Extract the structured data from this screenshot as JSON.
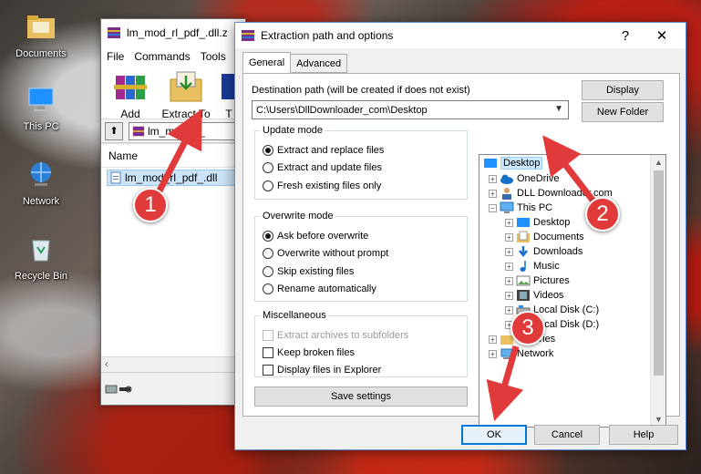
{
  "desktop": {
    "icons": [
      {
        "label": "Documents"
      },
      {
        "label": "This PC"
      },
      {
        "label": "Network"
      },
      {
        "label": "Recycle Bin"
      }
    ]
  },
  "winrar": {
    "title": "lm_mod_rl_pdf_.dll.z",
    "menu": [
      "File",
      "Commands",
      "Tools"
    ],
    "tools": {
      "add": "Add",
      "extract_to": "Extract To",
      "third": "T"
    },
    "path": "lm_mod_rl_",
    "column_name": "Name",
    "file": "lm_mod_rl_pdf_.dll"
  },
  "dialog": {
    "title": "Extraction path and options",
    "help": "?",
    "close": "✕",
    "tabs": [
      "General",
      "Advanced"
    ],
    "dest_label": "Destination path (will be created if does not exist)",
    "dest_value": "C:\\Users\\DllDownloader_com\\Desktop",
    "btn_display": "Display",
    "btn_new_folder": "New Folder",
    "update_mode": {
      "title": "Update mode",
      "options": [
        "Extract and replace files",
        "Extract and update files",
        "Fresh existing files only"
      ],
      "selected": 0
    },
    "overwrite_mode": {
      "title": "Overwrite mode",
      "options": [
        "Ask before overwrite",
        "Overwrite without prompt",
        "Skip existing files",
        "Rename automatically"
      ],
      "selected": 0
    },
    "misc": {
      "title": "Miscellaneous",
      "options": [
        "Extract archives to subfolders",
        "Keep broken files",
        "Display files in Explorer"
      ]
    },
    "btn_save": "Save settings",
    "tree": [
      {
        "label": "Desktop",
        "selected": true
      },
      {
        "label": "OneDrive"
      },
      {
        "label": "DLL Downloader.com"
      },
      {
        "label": "This PC"
      },
      {
        "label": "Desktop"
      },
      {
        "label": "Documents"
      },
      {
        "label": "Downloads"
      },
      {
        "label": "Music"
      },
      {
        "label": "Pictures"
      },
      {
        "label": "Videos"
      },
      {
        "label": "Local Disk (C:)"
      },
      {
        "label": "Local Disk (D:)"
      },
      {
        "label": "Libraries"
      },
      {
        "label": "Network"
      }
    ],
    "btn_ok": "OK",
    "btn_cancel": "Cancel",
    "btn_help": "Help"
  },
  "markers": [
    "1",
    "2",
    "3"
  ],
  "colors": {
    "marker": "#e03a3a",
    "selection": "#cce8ff",
    "accent": "#0078d7"
  }
}
